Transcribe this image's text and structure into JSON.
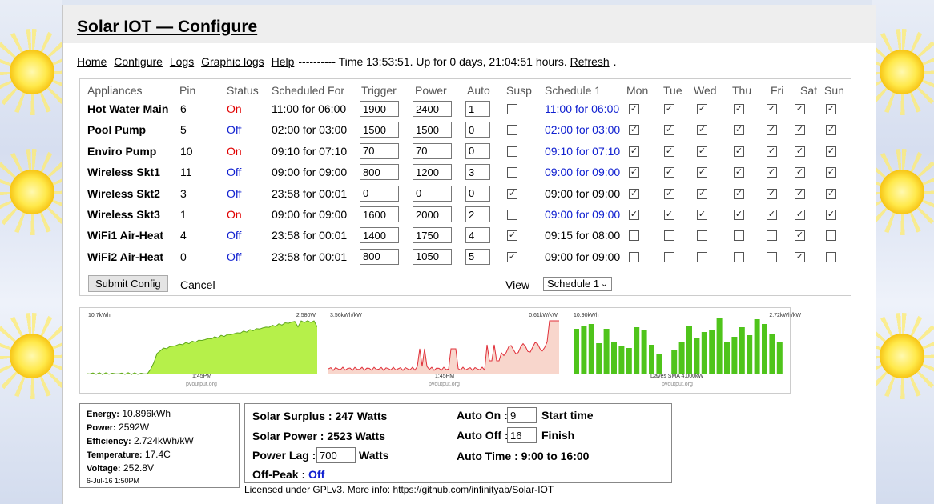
{
  "title": "Solar IOT — Configure",
  "nav": {
    "links": [
      "Home",
      "Configure",
      "Logs",
      "Graphic logs",
      "Help"
    ],
    "status": "---------- Time 13:53:51. Up for 0 days, 21:04:51 hours.",
    "refresh": "Refresh"
  },
  "table": {
    "headers": [
      "Appliances",
      "Pin",
      "Status",
      "Scheduled For",
      "Trigger",
      "Power",
      "Auto",
      "Susp",
      "Schedule 1",
      "Mon",
      "Tue",
      "Wed",
      "Thu",
      "Fri",
      "Sat",
      "Sun"
    ],
    "rows": [
      {
        "name": "Hot Water Main",
        "pin": "6",
        "status": "On",
        "sched": "11:00 for 06:00",
        "trigger": "1900",
        "power": "2400",
        "auto": "1",
        "susp": false,
        "s1": "11:00 for 06:00",
        "s1_blue": true,
        "days": [
          true,
          true,
          true,
          true,
          true,
          true,
          true
        ]
      },
      {
        "name": "Pool Pump",
        "pin": "5",
        "status": "Off",
        "sched": "02:00 for 03:00",
        "trigger": "1500",
        "power": "1500",
        "auto": "0",
        "susp": false,
        "s1": "02:00 for 03:00",
        "s1_blue": true,
        "days": [
          true,
          true,
          true,
          true,
          true,
          true,
          true
        ]
      },
      {
        "name": "Enviro Pump",
        "pin": "10",
        "status": "On",
        "sched": "09:10 for 07:10",
        "trigger": "70",
        "power": "70",
        "auto": "0",
        "susp": false,
        "s1": "09:10 for 07:10",
        "s1_blue": true,
        "days": [
          true,
          true,
          true,
          true,
          true,
          true,
          true
        ]
      },
      {
        "name": "Wireless Skt1",
        "pin": "11",
        "status": "Off",
        "sched": "09:00 for 09:00",
        "trigger": "800",
        "power": "1200",
        "auto": "3",
        "susp": false,
        "s1": "09:00 for 09:00",
        "s1_blue": true,
        "days": [
          true,
          true,
          true,
          true,
          true,
          true,
          true
        ]
      },
      {
        "name": "Wireless Skt2",
        "pin": "3",
        "status": "Off",
        "sched": "23:58 for 00:01",
        "trigger": "0",
        "power": "0",
        "auto": "0",
        "susp": true,
        "s1": "09:00 for 09:00",
        "s1_blue": false,
        "days": [
          true,
          true,
          true,
          true,
          true,
          true,
          true
        ]
      },
      {
        "name": "Wireless Skt3",
        "pin": "1",
        "status": "On",
        "sched": "09:00 for 09:00",
        "trigger": "1600",
        "power": "2000",
        "auto": "2",
        "susp": false,
        "s1": "09:00 for 09:00",
        "s1_blue": true,
        "days": [
          true,
          true,
          true,
          true,
          true,
          true,
          true
        ]
      },
      {
        "name": "WiFi1 Air-Heat",
        "pin": "4",
        "status": "Off",
        "sched": "23:58 for 00:01",
        "trigger": "1400",
        "power": "1750",
        "auto": "4",
        "susp": true,
        "s1": "09:15 for 08:00",
        "s1_blue": false,
        "days": [
          false,
          false,
          false,
          false,
          false,
          true,
          false
        ]
      },
      {
        "name": "WiFi2 Air-Heat",
        "pin": "0",
        "status": "Off",
        "sched": "23:58 for 00:01",
        "trigger": "800",
        "power": "1050",
        "auto": "5",
        "susp": true,
        "s1": "09:00 for 09:00",
        "s1_blue": false,
        "days": [
          false,
          false,
          false,
          false,
          false,
          true,
          false
        ]
      }
    ],
    "submit": "Submit Config",
    "cancel": "Cancel",
    "view_label": "View",
    "view_value": "Schedule 1"
  },
  "graphs": [
    {
      "tl": "10.7kWh",
      "tr": "2,580W",
      "x": "1:45PM",
      "src": "pvoutput.org"
    },
    {
      "tl": "3.56kWh/kW",
      "tr": "0.61kW/kW",
      "x": "1:45PM",
      "src": "pvoutput.org"
    },
    {
      "tl": "10.90kWh",
      "tr": "2.72kWh/kW",
      "x": "Daves SMA 4.000kW",
      "src": "pvoutput.org"
    }
  ],
  "stats": {
    "energy_l": "Energy:",
    "energy": "10.896kWh",
    "power_l": "Power:",
    "power": "2592W",
    "eff_l": "Efficiency:",
    "eff": "2.724kWh/kW",
    "temp_l": "Temperature:",
    "temp": "17.4C",
    "volt_l": "Voltage:",
    "volt": "252.8V",
    "date": "6-Jul-16 1:50PM"
  },
  "surplus": {
    "surplus": "Solar Surplus : 247 Watts",
    "solar": "Solar Power : 2523 Watts",
    "lag_l": "Power Lag :",
    "lag": "700",
    "watts": "Watts",
    "offpeak_l": "Off-Peak :",
    "offpeak": "Off",
    "auto_on_l": "Auto On :",
    "auto_on": "9",
    "start": "Start time",
    "auto_off_l": "Auto Off :",
    "auto_off": "16",
    "finish": "Finish",
    "auto_time": "Auto Time : 9:00 to 16:00"
  },
  "footer": {
    "pre": "Licensed under ",
    "gpl": "GPLv3",
    "mid": ". More info: ",
    "url": "https://github.com/infinityab/Solar-IOT"
  },
  "chart_colors": {
    "green": "#b6f04a",
    "green_line": "#5fa81a",
    "pink": "#f8d6cc",
    "red_line": "#e0303a",
    "bar": "#4fc41b"
  }
}
